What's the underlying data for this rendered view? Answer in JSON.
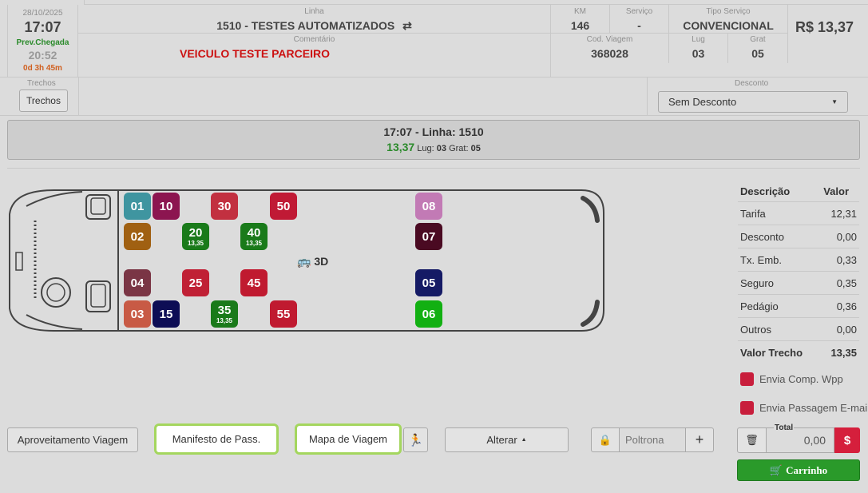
{
  "header": {
    "date": "28/10/2025",
    "time": "17:07",
    "prev_label": "Prev.Chegada",
    "arrival": "20:52",
    "duration": "0d 3h 45m",
    "linha_label": "Linha",
    "linha": "1510 - TESTES AUTOMATIZADOS",
    "comentario_label": "Comentário",
    "comentario": "VEICULO TESTE PARCEIRO",
    "km_label": "KM",
    "km": "146",
    "servico_label": "Serviço",
    "servico": "-",
    "tipo_label": "Tipo Serviço",
    "tipo": "CONVENCIONAL",
    "price": "R$ 13,37",
    "cod_label": "Cod. Viagem",
    "cod": "368028",
    "lug_label": "Lug",
    "lug": "03",
    "grat_label": "Grat",
    "grat": "05",
    "trechos_label": "Trechos",
    "trechos_button": "Trechos",
    "desconto_label": "Desconto",
    "desconto_value": "Sem Desconto"
  },
  "banner": {
    "line1": "17:07 - Linha: 1510",
    "value": "13,37",
    "lug_label": "Lug:",
    "lug": "03",
    "grat_label": "Grat:",
    "grat": "05"
  },
  "bus": {
    "label": "3D",
    "seats": [
      {
        "n": "01",
        "color": "#3f95a0"
      },
      {
        "n": "10",
        "color": "#8c1550"
      },
      {
        "n": "30",
        "color": "#c23040"
      },
      {
        "n": "50",
        "color": "#c01a35"
      },
      {
        "n": "08",
        "color": "#c27ab5"
      },
      {
        "n": "02",
        "color": "#a06012"
      },
      {
        "n": "20",
        "color": "#1a7a1a",
        "fare": "13,35"
      },
      {
        "n": "40",
        "color": "#1a7a1a",
        "fare": "13,35"
      },
      {
        "n": "07",
        "color": "#4a0a22"
      },
      {
        "n": "04",
        "color": "#7a3545"
      },
      {
        "n": "25",
        "color": "#c02035"
      },
      {
        "n": "45",
        "color": "#c01a30"
      },
      {
        "n": "05",
        "color": "#151a65"
      },
      {
        "n": "03",
        "color": "#c85a45"
      },
      {
        "n": "15",
        "color": "#0d0d55"
      },
      {
        "n": "35",
        "color": "#1a7a1a",
        "fare": "13,35"
      },
      {
        "n": "55",
        "color": "#c01a30"
      },
      {
        "n": "06",
        "color": "#12b012"
      }
    ]
  },
  "fare_table": {
    "col_desc": "Descrição",
    "col_val": "Valor",
    "rows": [
      {
        "label": "Tarifa",
        "value": "12,31"
      },
      {
        "label": "Desconto",
        "value": "0,00"
      },
      {
        "label": "Tx. Emb.",
        "value": "0,33"
      },
      {
        "label": "Seguro",
        "value": "0,35"
      },
      {
        "label": "Pedágio",
        "value": "0,36"
      },
      {
        "label": "Outros",
        "value": "0,00"
      }
    ],
    "total_label": "Valor Trecho",
    "total_value": "13,35"
  },
  "options": {
    "wpp": "Envia Comp. Wpp",
    "email": "Envia Passagem E-mail"
  },
  "actions": {
    "aproveitamento": "Aproveitamento Viagem",
    "manifesto": "Manifesto de Pass.",
    "mapa": "Mapa de Viagem",
    "alterar": "Alterar",
    "poltrona_placeholder": "Poltrona",
    "plus": "+",
    "total_label": "Total",
    "total_value": "0,00",
    "dollar": "$",
    "carrinho": "Carrinho"
  },
  "colors": {
    "accent_green": "#2a9a2a",
    "danger": "#c81e3c",
    "highlight": "#a4d65e"
  },
  "icons": [
    "repeat-icon",
    "caret-down-icon",
    "bus-icon",
    "walking-person-icon",
    "lock-icon",
    "trash-icon",
    "cart-icon"
  ]
}
